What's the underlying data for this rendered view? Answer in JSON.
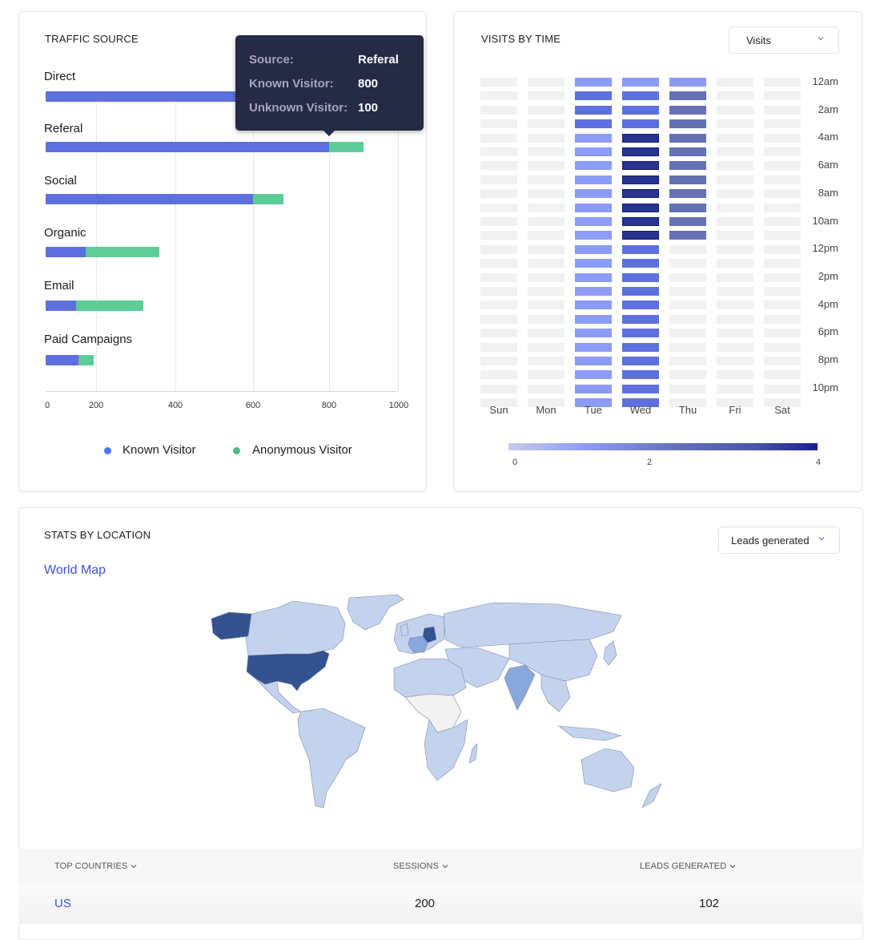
{
  "traffic_source": {
    "title": "TRAFFIC SOURCE",
    "tooltip": {
      "source_label": "Source:",
      "source_value": "Referal",
      "known_label": "Known Visitor:",
      "known_value": "800",
      "unknown_label": "Unknown Visitor:",
      "unknown_value": "100"
    },
    "legend": {
      "known": "Known Visitor",
      "anonymous": "Anonymous Visitor"
    },
    "colors": {
      "known": "#5e6fe0",
      "anonymous": "#5ccd96"
    }
  },
  "visits_by_time": {
    "title": "VISITS BY TIME",
    "dropdown_value": "Visits",
    "scale_ticks": [
      "0",
      "2",
      "4"
    ]
  },
  "stats_by_location": {
    "title": "STATS BY LOCATION",
    "dropdown_value": "Leads generated",
    "map_link": "World Map",
    "table": {
      "headers": [
        "TOP COUNTRIES",
        "SESSIONS",
        "LEADS GENERATED"
      ],
      "rows": [
        {
          "country": "US",
          "sessions": "200",
          "leads": "102"
        }
      ]
    },
    "map_colors": {
      "high": "#34528f",
      "mid": "#8aa7dd",
      "low": "#c3d3ee",
      "none": "#f2f2f2"
    },
    "highlighted_countries": [
      {
        "name": "United States",
        "level": "high"
      },
      {
        "name": "Germany",
        "level": "high"
      },
      {
        "name": "France",
        "level": "mid"
      },
      {
        "name": "India",
        "level": "mid"
      }
    ]
  },
  "chart_data": [
    {
      "type": "bar",
      "orientation": "horizontal",
      "stacked": true,
      "title": "TRAFFIC SOURCE",
      "categories": [
        "Direct",
        "Referal",
        "Social",
        "Organic",
        "Email",
        "Paid Campaigns"
      ],
      "series": [
        {
          "name": "Known Visitor",
          "values": [
            900,
            800,
            600,
            160,
            120,
            130
          ]
        },
        {
          "name": "Anonymous Visitor",
          "values": [
            100,
            100,
            80,
            200,
            200,
            60
          ]
        }
      ],
      "xticks": [
        "0",
        "200",
        "400",
        "600",
        "800",
        "1000"
      ],
      "xlim": [
        0,
        1000
      ],
      "grid": true,
      "legend": "bottom"
    },
    {
      "type": "heatmap",
      "title": "VISITS BY TIME",
      "x": [
        "Sun",
        "Mon",
        "Tue",
        "Wed",
        "Thu",
        "Fri",
        "Sat"
      ],
      "y": [
        "12am",
        "1am",
        "2am",
        "3am",
        "4am",
        "5am",
        "6am",
        "7am",
        "8am",
        "9am",
        "10am",
        "11am",
        "12pm",
        "1pm",
        "2pm",
        "3pm",
        "4pm",
        "5pm",
        "6pm",
        "7pm",
        "8pm",
        "9pm",
        "10pm",
        "11pm"
      ],
      "y_tick_labels": [
        "12am",
        "2am",
        "4am",
        "6am",
        "8am",
        "10am",
        "12pm",
        "2pm",
        "4pm",
        "6pm",
        "8pm",
        "10pm"
      ],
      "values": {
        "Sun": [
          0,
          0,
          0,
          0,
          0,
          0,
          0,
          0,
          0,
          0,
          0,
          0,
          0,
          0,
          0,
          0,
          0,
          0,
          0,
          0,
          0,
          0,
          0,
          0
        ],
        "Mon": [
          0,
          0,
          0,
          0,
          0,
          0,
          0,
          0,
          0,
          0,
          0,
          0,
          0,
          0,
          0,
          0,
          0,
          0,
          0,
          0,
          0,
          0,
          0,
          0
        ],
        "Tue": [
          1,
          1.5,
          1.5,
          1.5,
          1,
          1,
          1,
          1,
          1,
          1,
          1,
          1,
          1,
          1,
          1,
          1,
          1,
          1,
          1,
          1,
          1,
          1,
          1,
          1
        ],
        "Wed": [
          1,
          1.5,
          1.5,
          1.5,
          4,
          4,
          4,
          4,
          4,
          4,
          4,
          4,
          1.5,
          1.5,
          1.5,
          1.5,
          1.5,
          1.5,
          1.5,
          1.5,
          1.5,
          1.5,
          1.5,
          1.5
        ],
        "Thu": [
          1,
          3,
          3,
          3,
          3,
          3,
          3,
          3,
          3,
          3,
          3,
          3,
          0,
          0,
          0,
          0,
          0,
          0,
          0,
          0,
          0,
          0,
          0,
          0
        ],
        "Fri": [
          0,
          0,
          0,
          0,
          0,
          0,
          0,
          0,
          0,
          0,
          0,
          0,
          0,
          0,
          0,
          0,
          0,
          0,
          0,
          0,
          0,
          0,
          0,
          0
        ],
        "Sat": [
          0,
          0,
          0,
          0,
          0,
          0,
          0,
          0,
          0,
          0,
          0,
          0,
          0,
          0,
          0,
          0,
          0,
          0,
          0,
          0,
          0,
          0,
          0,
          0
        ]
      },
      "color_scale": {
        "min": 0,
        "max": 4,
        "ticks": [
          0,
          2,
          4
        ]
      },
      "legend": "bottom"
    }
  ]
}
